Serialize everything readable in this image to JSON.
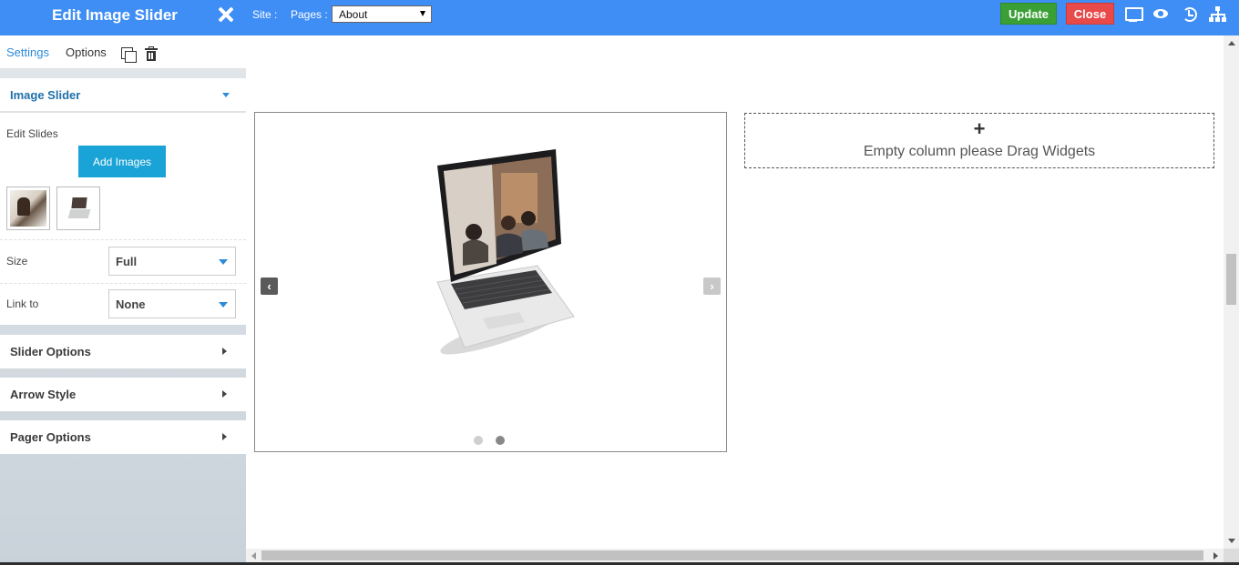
{
  "panel": {
    "title": "Edit Image Slider",
    "close_icon": "close-icon",
    "tabs": {
      "settings": "Settings",
      "options": "Options"
    },
    "actions": [
      "copy-icon",
      "trash-icon"
    ]
  },
  "image_slider_section": {
    "title": "Image Slider",
    "edit_slides_label": "Edit Slides",
    "add_images_label": "Add Images",
    "thumbnails": [
      "slide-1",
      "slide-2"
    ],
    "size": {
      "label": "Size",
      "value": "Full"
    },
    "link_to": {
      "label": "Link to",
      "value": "None"
    }
  },
  "sections": {
    "slider_options": "Slider Options",
    "arrow_style": "Arrow Style",
    "pager_options": "Pager Options"
  },
  "topbar": {
    "site_label": "Site :",
    "pages_label": "Pages :",
    "pages_value": "About",
    "update_label": "Update",
    "close_label": "Close",
    "icons": [
      "desktop-icon",
      "eye-icon",
      "history-icon",
      "sitemap-icon"
    ]
  },
  "canvas": {
    "slider": {
      "prev_arrow": "‹",
      "next_arrow": "›",
      "slide_count": 2,
      "active_slide": 2
    },
    "empty_column": {
      "plus": "+",
      "text": "Empty column please Drag Widgets"
    }
  },
  "colors": {
    "topbar": "#3f8ef5",
    "update": "#3aa035",
    "close": "#e84a4a",
    "add_images": "#1aa3d6",
    "accent_text": "#2e8bd8"
  }
}
